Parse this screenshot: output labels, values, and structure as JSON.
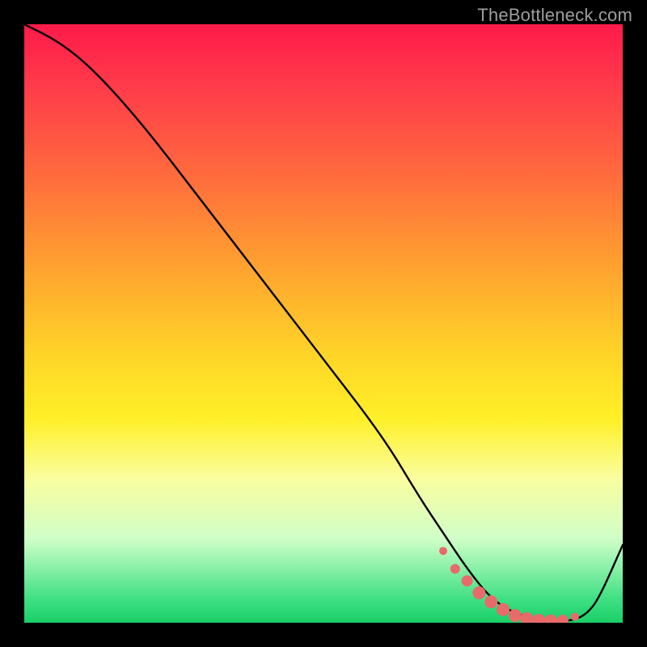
{
  "attribution": "TheBottleneck.com",
  "colors": {
    "gradient_top": "#ff1a4a",
    "gradient_mid": "#ffd428",
    "gradient_bottom": "#18cf66",
    "curve": "#000000",
    "marker": "#e86a6a",
    "background": "#000000"
  },
  "chart_data": {
    "type": "line",
    "title": "",
    "xlabel": "",
    "ylabel": "",
    "xlim": [
      0,
      100
    ],
    "ylim": [
      0,
      100
    ],
    "grid": false,
    "legend": false,
    "series": [
      {
        "name": "bottleneck-curve",
        "x": [
          0,
          6,
          12,
          20,
          30,
          40,
          50,
          60,
          66,
          70,
          74,
          78,
          82,
          86,
          88,
          90,
          92,
          94,
          96,
          100
        ],
        "values": [
          100,
          97,
          92,
          83,
          70,
          57,
          44,
          31,
          21,
          15,
          9,
          4,
          1.5,
          0.5,
          0.3,
          0.3,
          0.5,
          1.5,
          4,
          13
        ]
      }
    ],
    "markers": {
      "name": "optimal-region-markers",
      "x": [
        70,
        72,
        74,
        76,
        78,
        80,
        82,
        84,
        86,
        88,
        90,
        92
      ],
      "values": [
        12,
        9,
        7,
        5,
        3.5,
        2.2,
        1.2,
        0.7,
        0.4,
        0.3,
        0.4,
        1.0
      ],
      "radius": [
        5,
        6,
        7,
        8,
        8,
        8,
        8,
        8,
        8,
        8,
        7,
        5
      ]
    }
  }
}
